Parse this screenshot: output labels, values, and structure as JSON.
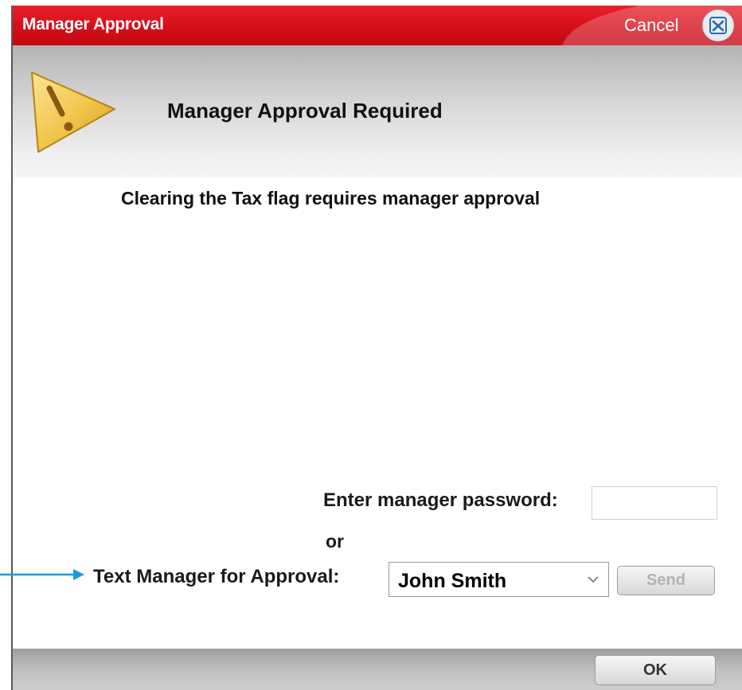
{
  "dialog": {
    "title": "Manager Approval",
    "cancel_label": "Cancel",
    "cancel_icon": "close-icon",
    "warning_icon": "warning-icon",
    "header_title": "Manager Approval Required",
    "message": "Clearing the Tax flag requires manager approval",
    "password": {
      "label": "Enter manager password:",
      "value": "",
      "placeholder": ""
    },
    "or_label": "or",
    "text_manager": {
      "label": "Text Manager for Approval:",
      "selected": "John Smith",
      "send_label": "Send",
      "send_enabled": false
    },
    "ok_label": "OK"
  },
  "colors": {
    "titlebar_red": "#d40f1a",
    "annotation_arrow": "#1a9be0"
  }
}
